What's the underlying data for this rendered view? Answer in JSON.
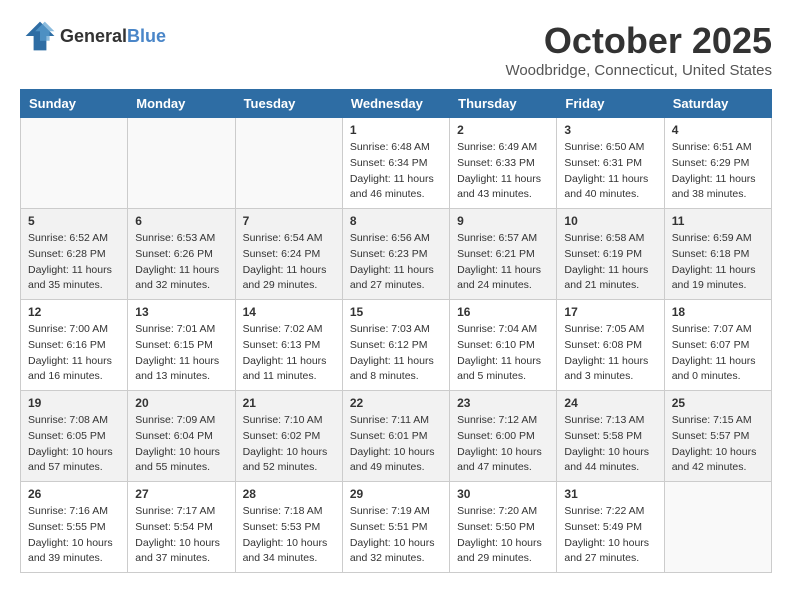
{
  "logo": {
    "general": "General",
    "blue": "Blue"
  },
  "header": {
    "month": "October 2025",
    "location": "Woodbridge, Connecticut, United States"
  },
  "weekdays": [
    "Sunday",
    "Monday",
    "Tuesday",
    "Wednesday",
    "Thursday",
    "Friday",
    "Saturday"
  ],
  "weeks": [
    [
      {
        "day": "",
        "sunrise": "",
        "sunset": "",
        "daylight": ""
      },
      {
        "day": "",
        "sunrise": "",
        "sunset": "",
        "daylight": ""
      },
      {
        "day": "",
        "sunrise": "",
        "sunset": "",
        "daylight": ""
      },
      {
        "day": "1",
        "sunrise": "Sunrise: 6:48 AM",
        "sunset": "Sunset: 6:34 PM",
        "daylight": "Daylight: 11 hours and 46 minutes."
      },
      {
        "day": "2",
        "sunrise": "Sunrise: 6:49 AM",
        "sunset": "Sunset: 6:33 PM",
        "daylight": "Daylight: 11 hours and 43 minutes."
      },
      {
        "day": "3",
        "sunrise": "Sunrise: 6:50 AM",
        "sunset": "Sunset: 6:31 PM",
        "daylight": "Daylight: 11 hours and 40 minutes."
      },
      {
        "day": "4",
        "sunrise": "Sunrise: 6:51 AM",
        "sunset": "Sunset: 6:29 PM",
        "daylight": "Daylight: 11 hours and 38 minutes."
      }
    ],
    [
      {
        "day": "5",
        "sunrise": "Sunrise: 6:52 AM",
        "sunset": "Sunset: 6:28 PM",
        "daylight": "Daylight: 11 hours and 35 minutes."
      },
      {
        "day": "6",
        "sunrise": "Sunrise: 6:53 AM",
        "sunset": "Sunset: 6:26 PM",
        "daylight": "Daylight: 11 hours and 32 minutes."
      },
      {
        "day": "7",
        "sunrise": "Sunrise: 6:54 AM",
        "sunset": "Sunset: 6:24 PM",
        "daylight": "Daylight: 11 hours and 29 minutes."
      },
      {
        "day": "8",
        "sunrise": "Sunrise: 6:56 AM",
        "sunset": "Sunset: 6:23 PM",
        "daylight": "Daylight: 11 hours and 27 minutes."
      },
      {
        "day": "9",
        "sunrise": "Sunrise: 6:57 AM",
        "sunset": "Sunset: 6:21 PM",
        "daylight": "Daylight: 11 hours and 24 minutes."
      },
      {
        "day": "10",
        "sunrise": "Sunrise: 6:58 AM",
        "sunset": "Sunset: 6:19 PM",
        "daylight": "Daylight: 11 hours and 21 minutes."
      },
      {
        "day": "11",
        "sunrise": "Sunrise: 6:59 AM",
        "sunset": "Sunset: 6:18 PM",
        "daylight": "Daylight: 11 hours and 19 minutes."
      }
    ],
    [
      {
        "day": "12",
        "sunrise": "Sunrise: 7:00 AM",
        "sunset": "Sunset: 6:16 PM",
        "daylight": "Daylight: 11 hours and 16 minutes."
      },
      {
        "day": "13",
        "sunrise": "Sunrise: 7:01 AM",
        "sunset": "Sunset: 6:15 PM",
        "daylight": "Daylight: 11 hours and 13 minutes."
      },
      {
        "day": "14",
        "sunrise": "Sunrise: 7:02 AM",
        "sunset": "Sunset: 6:13 PM",
        "daylight": "Daylight: 11 hours and 11 minutes."
      },
      {
        "day": "15",
        "sunrise": "Sunrise: 7:03 AM",
        "sunset": "Sunset: 6:12 PM",
        "daylight": "Daylight: 11 hours and 8 minutes."
      },
      {
        "day": "16",
        "sunrise": "Sunrise: 7:04 AM",
        "sunset": "Sunset: 6:10 PM",
        "daylight": "Daylight: 11 hours and 5 minutes."
      },
      {
        "day": "17",
        "sunrise": "Sunrise: 7:05 AM",
        "sunset": "Sunset: 6:08 PM",
        "daylight": "Daylight: 11 hours and 3 minutes."
      },
      {
        "day": "18",
        "sunrise": "Sunrise: 7:07 AM",
        "sunset": "Sunset: 6:07 PM",
        "daylight": "Daylight: 11 hours and 0 minutes."
      }
    ],
    [
      {
        "day": "19",
        "sunrise": "Sunrise: 7:08 AM",
        "sunset": "Sunset: 6:05 PM",
        "daylight": "Daylight: 10 hours and 57 minutes."
      },
      {
        "day": "20",
        "sunrise": "Sunrise: 7:09 AM",
        "sunset": "Sunset: 6:04 PM",
        "daylight": "Daylight: 10 hours and 55 minutes."
      },
      {
        "day": "21",
        "sunrise": "Sunrise: 7:10 AM",
        "sunset": "Sunset: 6:02 PM",
        "daylight": "Daylight: 10 hours and 52 minutes."
      },
      {
        "day": "22",
        "sunrise": "Sunrise: 7:11 AM",
        "sunset": "Sunset: 6:01 PM",
        "daylight": "Daylight: 10 hours and 49 minutes."
      },
      {
        "day": "23",
        "sunrise": "Sunrise: 7:12 AM",
        "sunset": "Sunset: 6:00 PM",
        "daylight": "Daylight: 10 hours and 47 minutes."
      },
      {
        "day": "24",
        "sunrise": "Sunrise: 7:13 AM",
        "sunset": "Sunset: 5:58 PM",
        "daylight": "Daylight: 10 hours and 44 minutes."
      },
      {
        "day": "25",
        "sunrise": "Sunrise: 7:15 AM",
        "sunset": "Sunset: 5:57 PM",
        "daylight": "Daylight: 10 hours and 42 minutes."
      }
    ],
    [
      {
        "day": "26",
        "sunrise": "Sunrise: 7:16 AM",
        "sunset": "Sunset: 5:55 PM",
        "daylight": "Daylight: 10 hours and 39 minutes."
      },
      {
        "day": "27",
        "sunrise": "Sunrise: 7:17 AM",
        "sunset": "Sunset: 5:54 PM",
        "daylight": "Daylight: 10 hours and 37 minutes."
      },
      {
        "day": "28",
        "sunrise": "Sunrise: 7:18 AM",
        "sunset": "Sunset: 5:53 PM",
        "daylight": "Daylight: 10 hours and 34 minutes."
      },
      {
        "day": "29",
        "sunrise": "Sunrise: 7:19 AM",
        "sunset": "Sunset: 5:51 PM",
        "daylight": "Daylight: 10 hours and 32 minutes."
      },
      {
        "day": "30",
        "sunrise": "Sunrise: 7:20 AM",
        "sunset": "Sunset: 5:50 PM",
        "daylight": "Daylight: 10 hours and 29 minutes."
      },
      {
        "day": "31",
        "sunrise": "Sunrise: 7:22 AM",
        "sunset": "Sunset: 5:49 PM",
        "daylight": "Daylight: 10 hours and 27 minutes."
      },
      {
        "day": "",
        "sunrise": "",
        "sunset": "",
        "daylight": ""
      }
    ]
  ]
}
